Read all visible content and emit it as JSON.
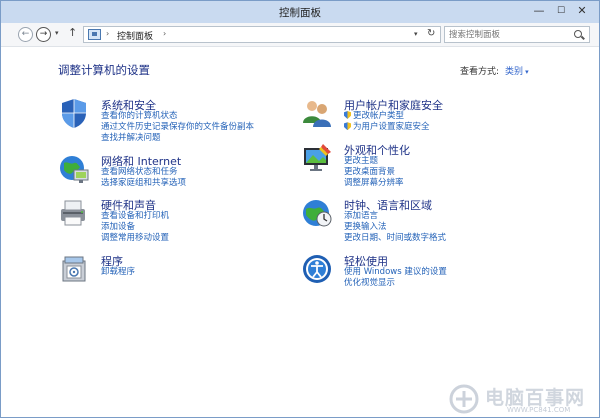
{
  "window": {
    "title": "控制面板",
    "min_glyph": "—",
    "max_glyph": "☐",
    "close_glyph": "✕"
  },
  "navigation": {
    "back_glyph": "←",
    "forward_glyph": "→",
    "dropdown_glyph": "▾",
    "up_glyph": "↑",
    "address_sep": "›",
    "address_text": "控制面板",
    "refresh_glyph": "↻",
    "search_placeholder": "搜索控制面板"
  },
  "main": {
    "heading": "调整计算机的设置",
    "view_by_label": "查看方式:",
    "view_by_value": "类别",
    "view_by_caret": "▾"
  },
  "categories": [
    {
      "icon": "system-security-icon",
      "title": "系统和安全",
      "links": [
        "查看你的计算机状态",
        "通过文件历史记录保存你的文件备份副本",
        "查找并解决问题"
      ]
    },
    {
      "icon": "network-internet-icon",
      "title": "网络和 Internet",
      "links": [
        "查看网络状态和任务",
        "选择家庭组和共享选项"
      ]
    },
    {
      "icon": "hardware-sound-icon",
      "title": "硬件和声音",
      "links": [
        "查看设备和打印机",
        "添加设备",
        "调整常用移动设置"
      ]
    },
    {
      "icon": "programs-icon",
      "title": "程序",
      "links": [
        "卸载程序"
      ]
    },
    {
      "icon": "user-accounts-icon",
      "title": "用户帐户和家庭安全",
      "links": [
        "更改帐户类型",
        "为用户设置家庭安全"
      ]
    },
    {
      "icon": "appearance-icon",
      "title": "外观和个性化",
      "links": [
        "更改主题",
        "更改桌面背景",
        "调整屏幕分辨率"
      ]
    },
    {
      "icon": "clock-language-icon",
      "title": "时钟、语言和区域",
      "links": [
        "添加语言",
        "更换输入法",
        "更改日期、时间或数字格式"
      ]
    },
    {
      "icon": "ease-of-access-icon",
      "title": "轻松使用",
      "links": [
        "使用 Windows 建议的设置",
        "优化视觉显示"
      ]
    }
  ],
  "watermark": {
    "text": "电脑百事网",
    "url": "WWW.PC841.COM"
  }
}
